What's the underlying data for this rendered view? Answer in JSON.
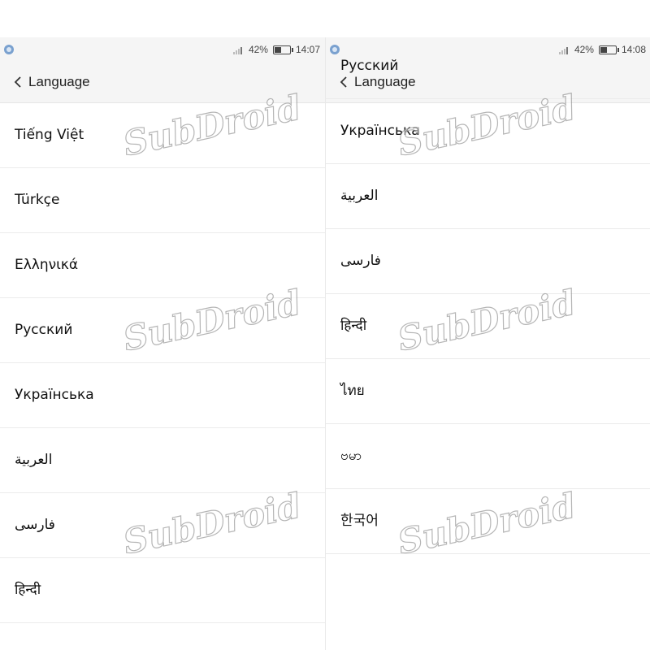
{
  "watermark": "SubDroid",
  "screens": [
    {
      "status": {
        "battery": "42%",
        "time": "14:07"
      },
      "title": "Language",
      "languages": [
        "Tiếng Việt",
        "Türkçe",
        "Ελληνικά",
        "Русский",
        "Українська",
        "العربية",
        "فارسی",
        "हिन्दी"
      ]
    },
    {
      "status": {
        "battery": "42%",
        "time": "14:08"
      },
      "title": "Language",
      "languages": [
        "Русский",
        "Українська",
        "العربية",
        "فارسی",
        "हिन्दी",
        "ไทย",
        "ဗမာ",
        "한국어"
      ]
    }
  ],
  "icons": {
    "notification": "app-notification-icon",
    "signal": "signal-icon",
    "battery": "battery-icon",
    "back": "chevron-left-icon"
  },
  "colors": {
    "statusbar_bg": "#f5f5f5",
    "divider": "#ebebeb",
    "text": "#111111"
  }
}
